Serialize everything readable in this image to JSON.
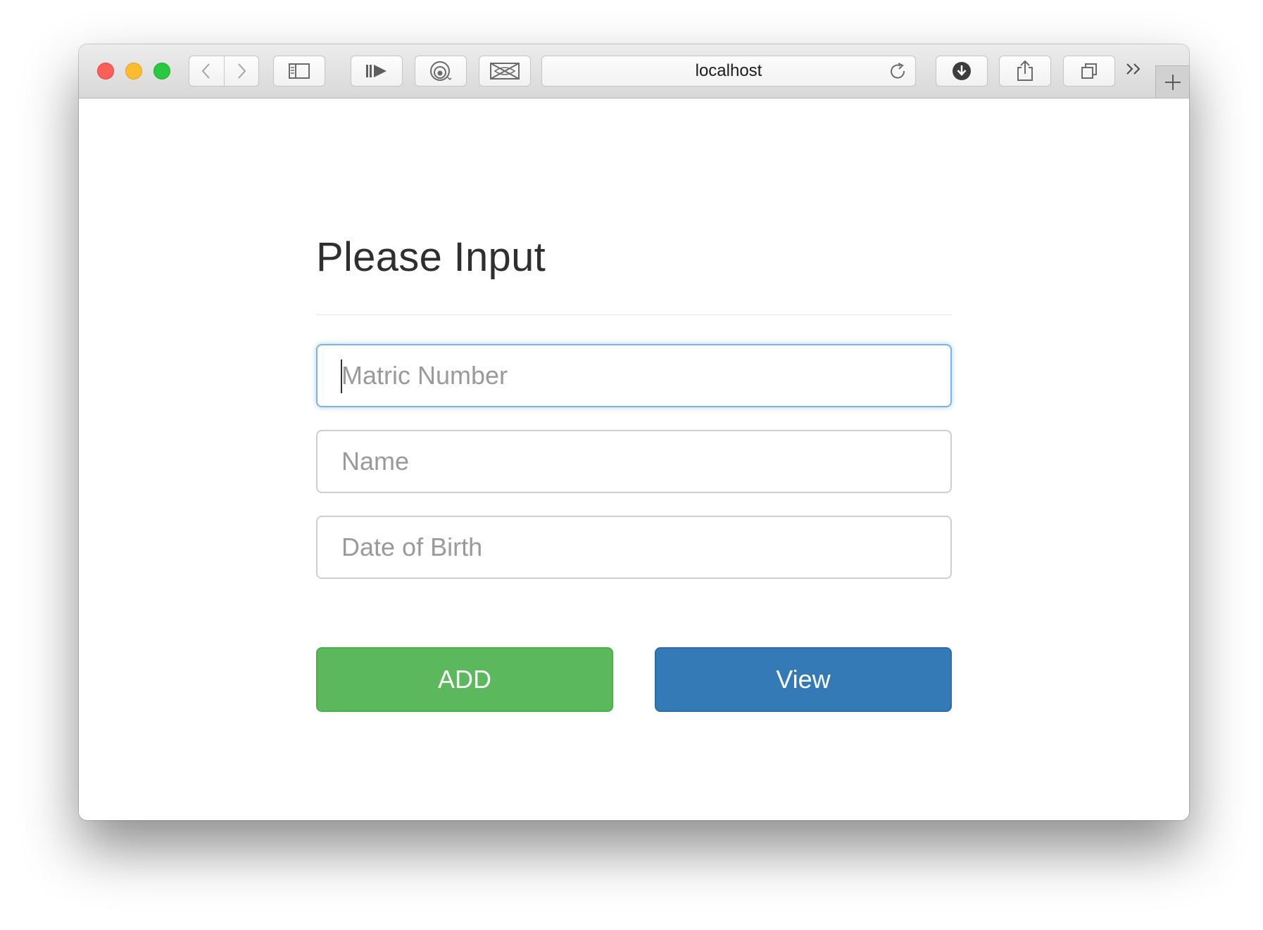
{
  "browser": {
    "address": "localhost"
  },
  "form": {
    "title": "Please Input",
    "fields": [
      {
        "placeholder": "Matric Number",
        "value": "",
        "focused": true
      },
      {
        "placeholder": "Name",
        "value": "",
        "focused": false
      },
      {
        "placeholder": "Date of Birth",
        "value": "",
        "focused": false
      }
    ],
    "buttons": {
      "add": "ADD",
      "view": "View"
    }
  },
  "colors": {
    "add_button": "#5cb85c",
    "view_button": "#337ab7",
    "focus_border": "#7cb3e6",
    "close_light": "#fc5f57",
    "minimize_light": "#fdbc2e",
    "maximize_light": "#28c840"
  }
}
